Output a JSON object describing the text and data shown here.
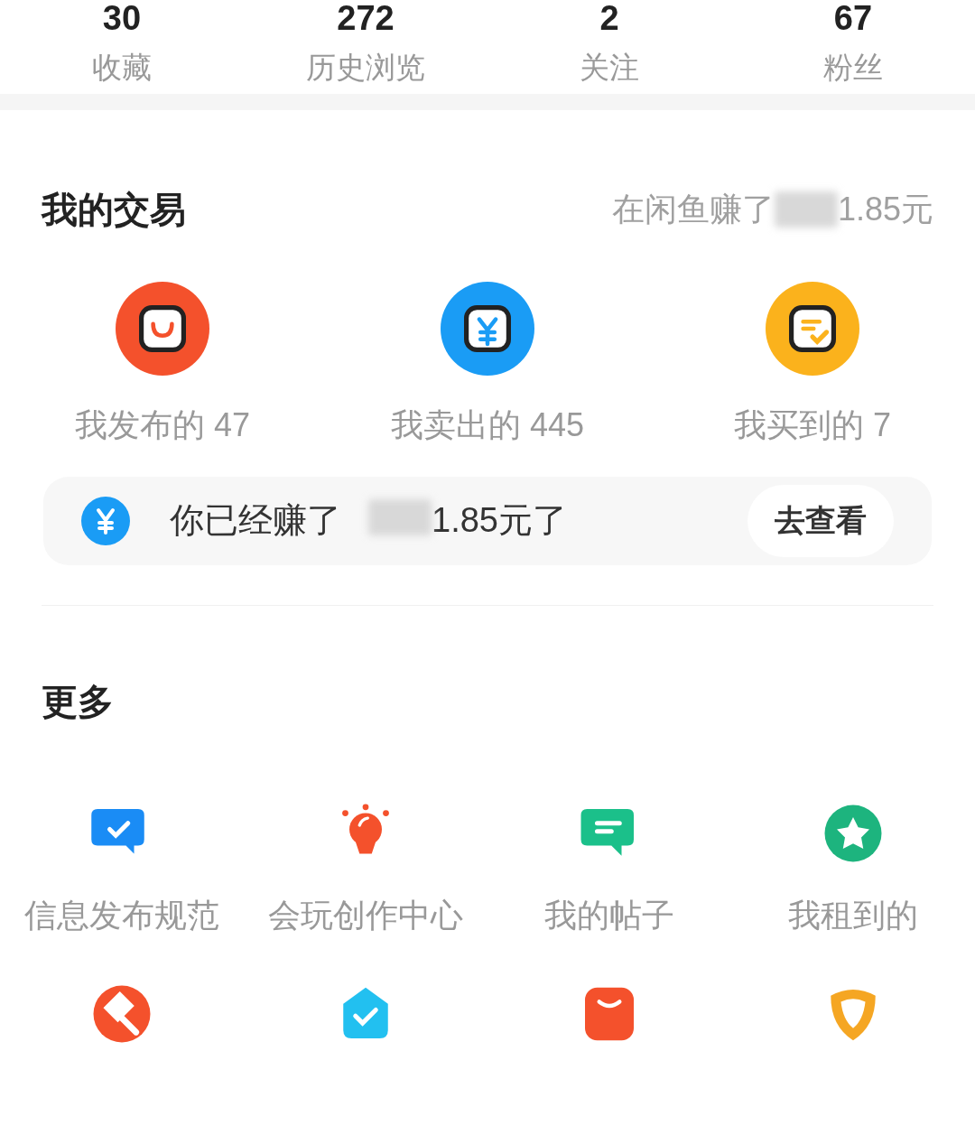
{
  "stats": [
    {
      "value": "30",
      "label": "收藏"
    },
    {
      "value": "272",
      "label": "历史浏览"
    },
    {
      "value": "2",
      "label": "关注"
    },
    {
      "value": "67",
      "label": "粉丝"
    }
  ],
  "trade": {
    "title": "我的交易",
    "earned_prefix": "在闲鱼赚了",
    "earned_suffix": "1.85元",
    "items": [
      {
        "kind": "bag",
        "color": "#f4512c",
        "label": "我发布的 47"
      },
      {
        "kind": "yen",
        "color": "#1a9cf5",
        "label": "我卖出的 445"
      },
      {
        "kind": "note",
        "color": "#fbb21c",
        "label": "我买到的 7"
      }
    ]
  },
  "banner": {
    "prefix": "你已经赚了",
    "suffix": "1.85元了",
    "button": "去查看"
  },
  "more": {
    "title": "更多",
    "items": [
      {
        "kind": "check-card",
        "color": "#1a8cf5",
        "label": "信息发布规范"
      },
      {
        "kind": "bulb",
        "color": "#f4512c",
        "label": "会玩创作中心"
      },
      {
        "kind": "note-card",
        "color": "#1bc08a",
        "label": "我的帖子"
      },
      {
        "kind": "star-circle",
        "color": "#1db47e",
        "label": "我租到的"
      },
      {
        "kind": "hammer",
        "color": "#f4512c"
      },
      {
        "kind": "shield-check",
        "color": "#22c0f0"
      },
      {
        "kind": "bag-plain",
        "color": "#f4512c"
      },
      {
        "kind": "shield",
        "color": "#f5a623"
      }
    ]
  }
}
